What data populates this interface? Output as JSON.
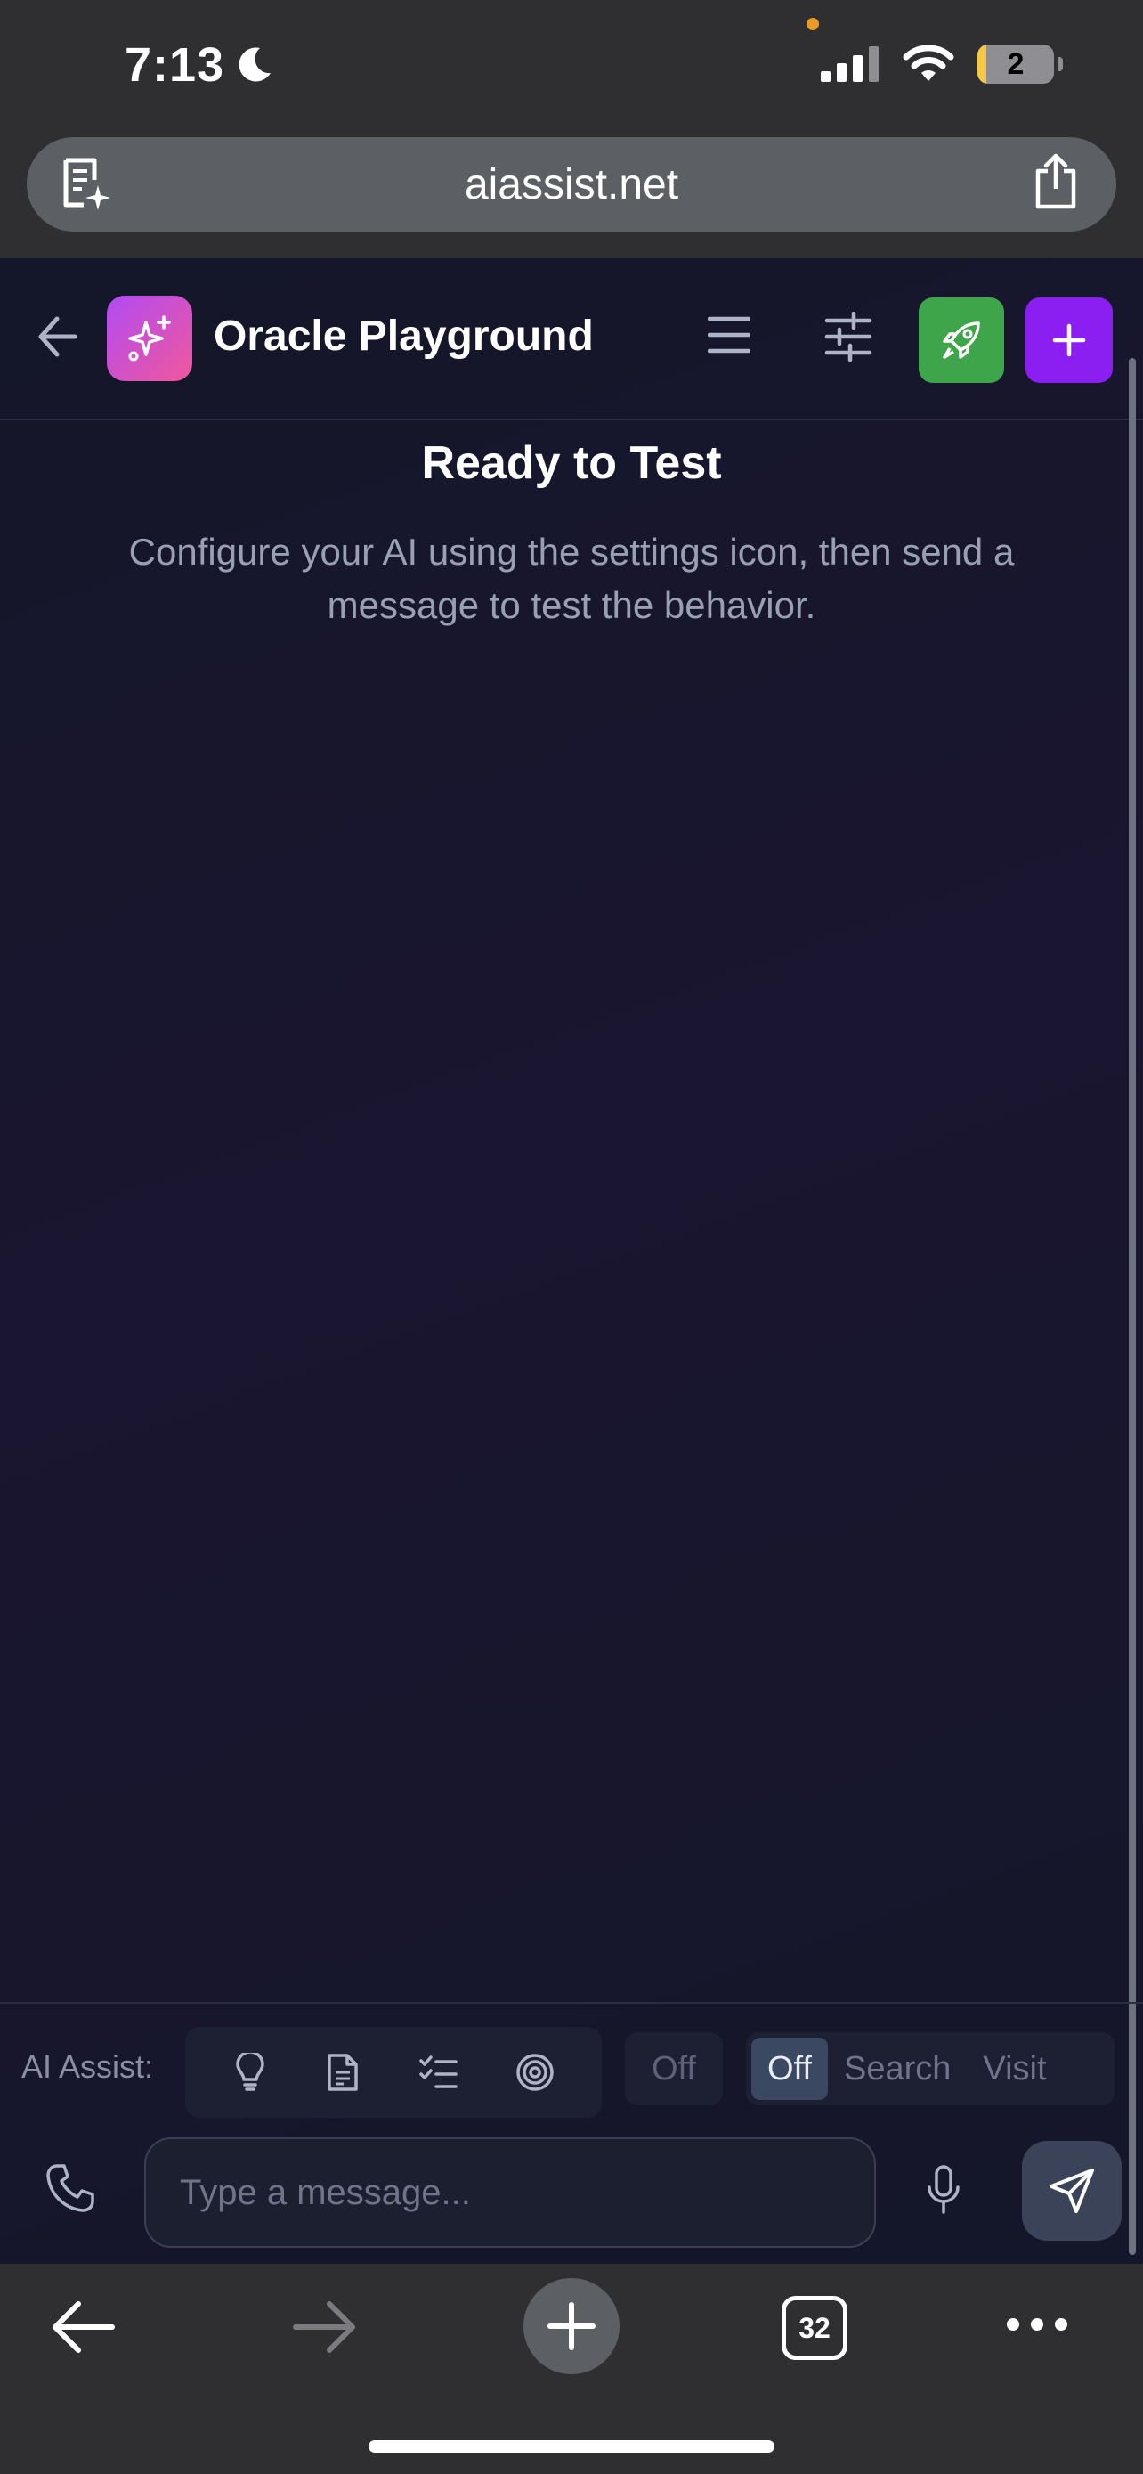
{
  "status_bar": {
    "time": "7:13",
    "battery": "2"
  },
  "browser": {
    "url": "aiassist.net",
    "tab_count": "32"
  },
  "header": {
    "title": "Oracle Playground"
  },
  "empty_state": {
    "title": "Ready to Test",
    "subtitle": "Configure your AI using the settings icon, then send a message to test the behavior."
  },
  "assist_bar": {
    "label": "AI Assist:",
    "tools": [
      "lightbulb-icon",
      "document-icon",
      "checklist-icon",
      "target-icon"
    ],
    "toggle_label": "Off",
    "web_mode": {
      "options": [
        "Off",
        "Search",
        "Visit"
      ],
      "selected": "Off"
    }
  },
  "composer": {
    "placeholder": "Type a message..."
  },
  "colors": {
    "accent_purple": "#8b1ef0",
    "accent_green": "#3fa54a",
    "logo_gradient_start": "#b14bf4",
    "logo_gradient_end": "#f0579b"
  }
}
